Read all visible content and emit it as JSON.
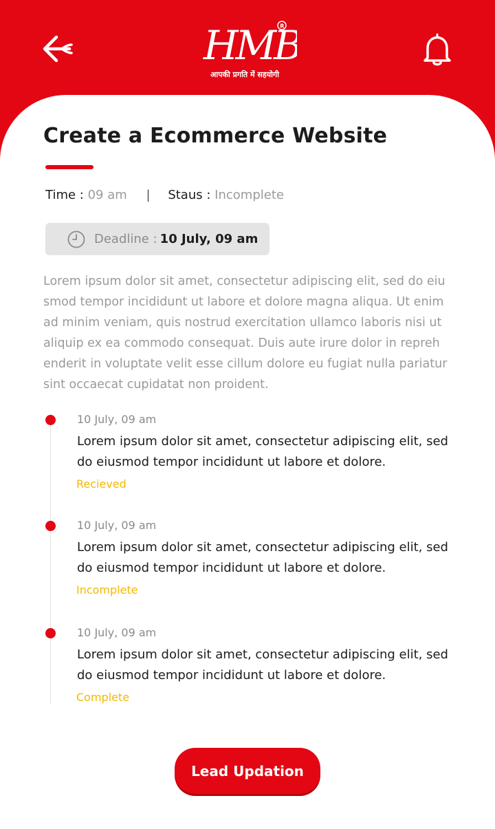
{
  "header": {
    "logo_text": "HMB",
    "logo_tagline": "आपकी प्रगति में सहयोगी",
    "back_icon": "back-arrow-icon",
    "bell_icon": "bell-icon"
  },
  "task": {
    "title": "Create a Ecommerce Website",
    "time_label": "Time :",
    "time_value": "09 am",
    "separator": "|",
    "status_label": "Staus :",
    "status_value": "Incomplete",
    "deadline_label": "Deadline :",
    "deadline_value": "10 July, 09 am",
    "description": "Lorem ipsum dolor sit amet, consectetur adipiscing elit, sed do eiu smod tempor incididunt ut labore et dolore magna aliqua. Ut enim ad minim veniam, quis nostrud exercitation ullamco laboris nisi ut aliquip ex ea commodo consequat. Duis aute irure dolor in repreh enderit in voluptate velit esse cillum dolore eu fugiat nulla pariatur sint occaecat cupidatat non proident."
  },
  "timeline": [
    {
      "date": "10 July, 09 am",
      "text": "Lorem ipsum dolor sit amet, consectetur adipiscing elit, sed do eiusmod tempor incididunt ut labore et dolore.",
      "status": "Recieved"
    },
    {
      "date": "10 July, 09 am",
      "text": "Lorem ipsum dolor sit amet, consectetur adipiscing elit, sed do eiusmod tempor incididunt ut labore et dolore.",
      "status": "Incomplete"
    },
    {
      "date": "10 July, 09 am",
      "text": "Lorem ipsum dolor sit amet, consectetur adipiscing elit, sed do eiusmod tempor incididunt ut labore et dolore.",
      "status": "Complete"
    }
  ],
  "actions": {
    "lead_button": "Lead Updation"
  },
  "colors": {
    "brand_red": "#e30613",
    "status_yellow": "#f5b800",
    "muted_gray": "#9a9a9a"
  }
}
